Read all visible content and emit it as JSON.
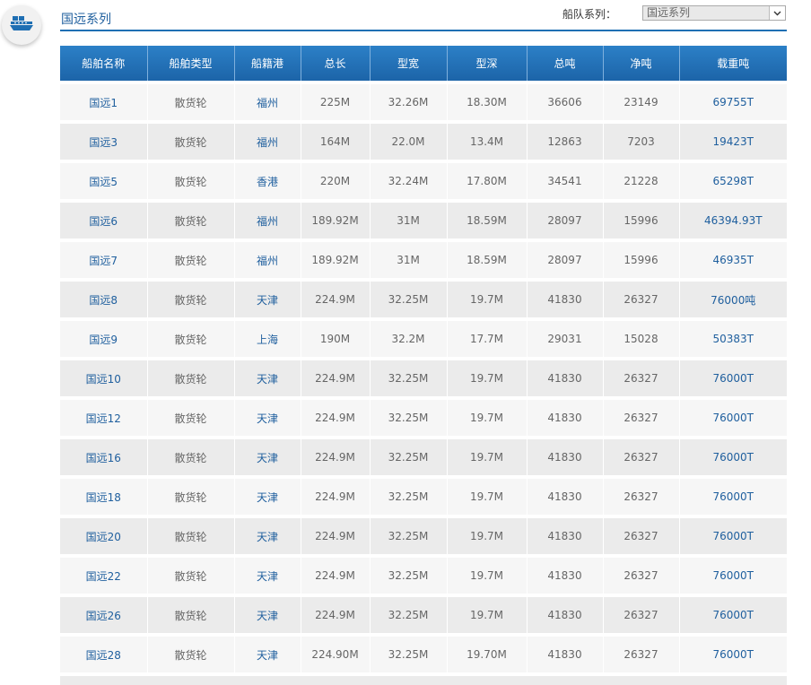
{
  "header": {
    "title": "国远系列",
    "fleet_label": "船队系列：",
    "fleet_select_value": "国远系列"
  },
  "icons": {
    "logo": "ship-icon",
    "dropdown": "chevron-down-icon"
  },
  "colors": {
    "header_bg": "#2475bb",
    "link_blue": "#1f5f9e",
    "row_light": "#f6f6f6",
    "row_dark": "#ebebeb"
  },
  "table": {
    "columns": [
      "船舶名称",
      "船舶类型",
      "船籍港",
      "总长",
      "型宽",
      "型深",
      "总吨",
      "净吨",
      "载重吨"
    ],
    "rows": [
      [
        "国远1",
        "散货轮",
        "福州",
        "225M",
        "32.26M",
        "18.30M",
        "36606",
        "23149",
        "69755T"
      ],
      [
        "国远3",
        "散货轮",
        "福州",
        "164M",
        "22.0M",
        "13.4M",
        "12863",
        "7203",
        "19423T"
      ],
      [
        "国远5",
        "散货轮",
        "香港",
        "220M",
        "32.24M",
        "17.80M",
        "34541",
        "21228",
        "65298T"
      ],
      [
        "国远6",
        "散货轮",
        "福州",
        "189.92M",
        "31M",
        "18.59M",
        "28097",
        "15996",
        "46394.93T"
      ],
      [
        "国远7",
        "散货轮",
        "福州",
        "189.92M",
        "31M",
        "18.59M",
        "28097",
        "15996",
        "46935T"
      ],
      [
        "国远8",
        "散货轮",
        "天津",
        "224.9M",
        "32.25M",
        "19.7M",
        "41830",
        "26327",
        "76000吨"
      ],
      [
        "国远9",
        "散货轮",
        "上海",
        "190M",
        "32.2M",
        "17.7M",
        "29031",
        "15028",
        "50383T"
      ],
      [
        "国远10",
        "散货轮",
        "天津",
        "224.9M",
        "32.25M",
        "19.7M",
        "41830",
        "26327",
        "76000T"
      ],
      [
        "国远12",
        "散货轮",
        "天津",
        "224.9M",
        "32.25M",
        "19.7M",
        "41830",
        "26327",
        "76000T"
      ],
      [
        "国远16",
        "散货轮",
        "天津",
        "224.9M",
        "32.25M",
        "19.7M",
        "41830",
        "26327",
        "76000T"
      ],
      [
        "国远18",
        "散货轮",
        "天津",
        "224.9M",
        "32.25M",
        "19.7M",
        "41830",
        "26327",
        "76000T"
      ],
      [
        "国远20",
        "散货轮",
        "天津",
        "224.9M",
        "32.25M",
        "19.7M",
        "41830",
        "26327",
        "76000T"
      ],
      [
        "国远22",
        "散货轮",
        "天津",
        "224.9M",
        "32.25M",
        "19.7M",
        "41830",
        "26327",
        "76000T"
      ],
      [
        "国远26",
        "散货轮",
        "天津",
        "224.9M",
        "32.25M",
        "19.7M",
        "41830",
        "26327",
        "76000T"
      ],
      [
        "国远28",
        "散货轮",
        "天津",
        "224.90M",
        "32.25M",
        "19.70M",
        "41830",
        "26327",
        "76000T"
      ]
    ]
  }
}
